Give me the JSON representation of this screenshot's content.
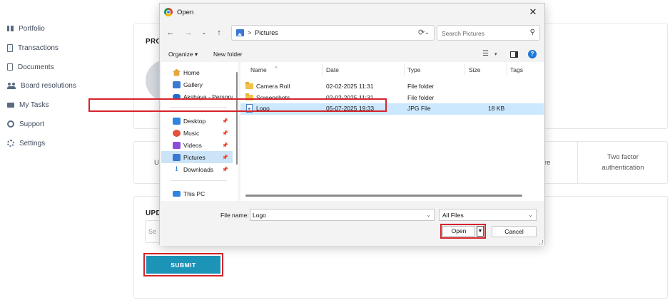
{
  "sidebar": {
    "items": [
      {
        "label": "Portfolio",
        "icon": "bar-chart-icon"
      },
      {
        "label": "Transactions",
        "icon": "clipboard-icon"
      },
      {
        "label": "Documents",
        "icon": "document-icon"
      },
      {
        "label": "Board resolutions",
        "icon": "group-icon"
      },
      {
        "label": "My Tasks",
        "icon": "envelope-icon"
      },
      {
        "label": "Support",
        "icon": "support-icon"
      },
      {
        "label": "Settings",
        "icon": "gear-icon"
      }
    ]
  },
  "main": {
    "profile_title_partial": "PRO",
    "tabs_partial_left": "U",
    "tabs_partial_right": "re",
    "two_factor_line1": "Two factor",
    "two_factor_line2": "authentication",
    "update_title_partial": "UPD",
    "update_input_partial": "Se",
    "submit_label": "SUBMIT"
  },
  "dialog": {
    "title": "Open",
    "breadcrumb_sep": ">",
    "location": "Pictures",
    "search_placeholder": "Search Pictures",
    "organize_label": "Organize ▾",
    "new_folder_label": "New folder",
    "nav_items": [
      {
        "label": "Home",
        "icon": "home-icon",
        "pinned": false,
        "selected": false
      },
      {
        "label": "Gallery",
        "icon": "gallery-icon",
        "pinned": false,
        "selected": false
      },
      {
        "label": "Akshaya - Persona",
        "icon": "onedrive-cloud-icon",
        "pinned": false,
        "selected": false
      },
      {
        "label": "Desktop",
        "icon": "desktop-icon",
        "pinned": true,
        "selected": false
      },
      {
        "label": "Music",
        "icon": "music-icon",
        "pinned": true,
        "selected": false
      },
      {
        "label": "Videos",
        "icon": "videos-icon",
        "pinned": true,
        "selected": false
      },
      {
        "label": "Pictures",
        "icon": "pictures-icon",
        "pinned": true,
        "selected": true
      },
      {
        "label": "Downloads",
        "icon": "download-icon",
        "pinned": true,
        "selected": false
      },
      {
        "label": "This PC",
        "icon": "this-pc-icon",
        "pinned": false,
        "selected": false
      }
    ],
    "columns": [
      "Name",
      "Date",
      "Type",
      "Size",
      "Tags"
    ],
    "files": [
      {
        "name": "Camera Roll",
        "date": "02-02-2025 11:31",
        "type": "File folder",
        "size": "",
        "kind": "folder"
      },
      {
        "name": "Screenshots",
        "date": "02-02-2025 11:31",
        "type": "File folder",
        "size": "",
        "kind": "folder"
      },
      {
        "name": "Logo",
        "date": "05-07-2025 19:33",
        "type": "JPG File",
        "size": "18 KB",
        "kind": "file",
        "selected": true
      }
    ],
    "file_name_label": "File name:",
    "file_name_value": "Logo",
    "file_type_filter": "All Files",
    "open_label": "Open",
    "cancel_label": "Cancel"
  },
  "colors": {
    "accent_red_outline": "#d6232b",
    "submit_blue": "#1c94b8",
    "selection_blue": "#cce8ff"
  }
}
